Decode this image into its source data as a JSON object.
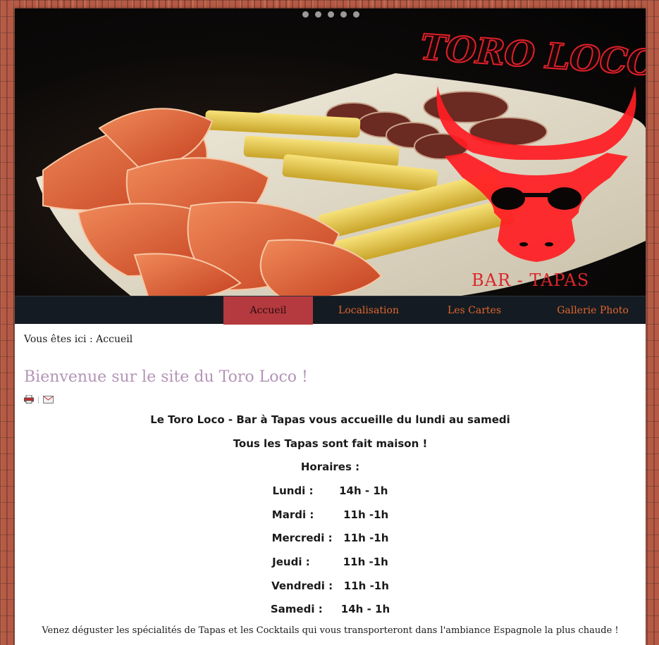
{
  "banner": {
    "slides": 5,
    "logo_title": "TORO LOCO",
    "logo_subtitle": "BAR - TAPAS",
    "brand_color": "#e0202a"
  },
  "nav": {
    "items": [
      {
        "label": "Accueil",
        "active": true
      },
      {
        "label": "Localisation",
        "active": false
      },
      {
        "label": "Les Cartes",
        "active": false
      },
      {
        "label": "Gallerie Photo",
        "active": false
      }
    ]
  },
  "breadcrumb": "Vous êtes ici : Accueil",
  "title": "Bienvenue sur le site du Toro Loco !",
  "tools": {
    "print_icon": "printer-icon",
    "email_icon": "email-icon"
  },
  "content": {
    "intro": "Le Toro Loco - Bar à Tapas vous accueille du lundi au samedi",
    "homemade": "Tous les Tapas sont fait maison !",
    "hours_title": "Horaires :",
    "hours": [
      "Lundi :       14h - 1h",
      "Mardi :        11h -1h",
      "Mercredi :   11h -1h",
      "Jeudi :         11h -1h",
      "Vendredi :   11h -1h",
      "Samedi :     14h - 1h"
    ],
    "footer": "Venez déguster les spécialités de Tapas et les Cocktails qui vous transporteront dans l'ambiance Espagnole la plus chaude !"
  }
}
